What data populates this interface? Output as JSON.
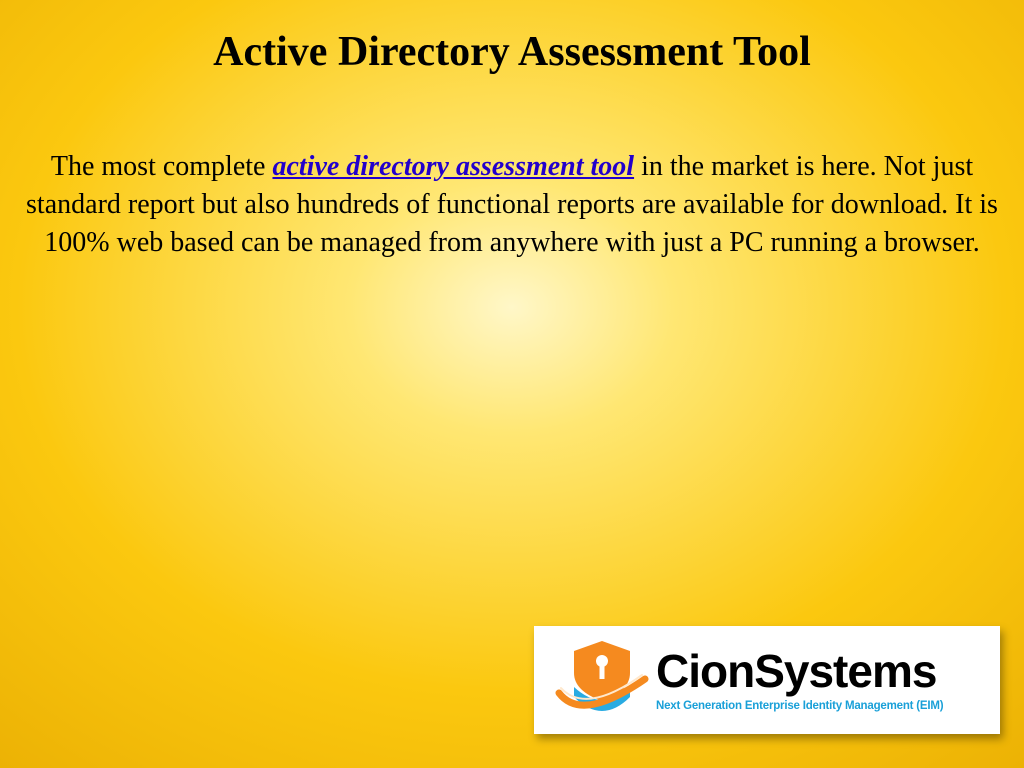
{
  "title": "Active Directory Assessment Tool",
  "body": {
    "pre": "The most complete ",
    "link": "active directory assessment tool",
    "post": " in the market is here. Not just standard report but also hundreds of functional reports are available for download. It is 100% web based can be managed from anywhere with just a PC running a browser."
  },
  "logo": {
    "name": "CionSystems",
    "tagline": "Next Generation Enterprise Identity Management (EIM)"
  }
}
